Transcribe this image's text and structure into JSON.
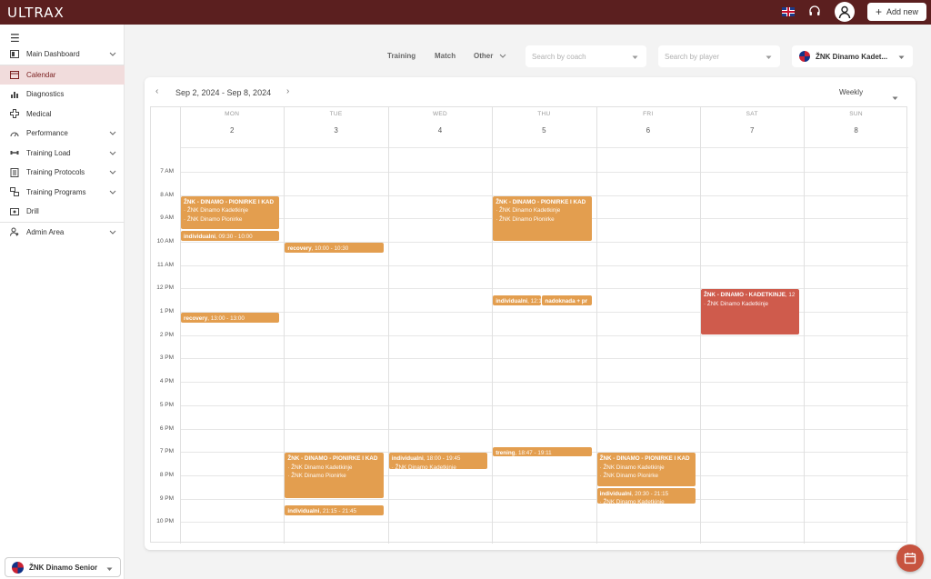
{
  "app": {
    "logo": "ULTRAX"
  },
  "header": {
    "add_new_label": "Add new",
    "icons": [
      "uk-flag-icon",
      "headset-icon",
      "user-avatar-icon"
    ]
  },
  "sidebar": {
    "items": [
      {
        "label": "Main Dashboard",
        "icon": "dashboard-icon",
        "expandable": true
      },
      {
        "label": "Calendar",
        "icon": "calendar-icon",
        "expandable": false,
        "active": true
      },
      {
        "label": "Diagnostics",
        "icon": "bar-chart-icon",
        "expandable": false
      },
      {
        "label": "Medical",
        "icon": "medical-icon",
        "expandable": false
      },
      {
        "label": "Performance",
        "icon": "speed-icon",
        "expandable": true
      },
      {
        "label": "Training Load",
        "icon": "load-icon",
        "expandable": true
      },
      {
        "label": "Training Protocols",
        "icon": "protocol-icon",
        "expandable": true
      },
      {
        "label": "Training Programs",
        "icon": "program-icon",
        "expandable": true
      },
      {
        "label": "Drill",
        "icon": "drill-icon",
        "expandable": false
      },
      {
        "label": "Admin Area",
        "icon": "admin-icon",
        "expandable": true
      }
    ],
    "team_selector": "ŽNK Dinamo Senior"
  },
  "filters": {
    "training": "Training",
    "match": "Match",
    "other": "Other",
    "coach_placeholder": "Search by coach",
    "player_placeholder": "Search by player",
    "team": "ŽNK Dinamo Kadet..."
  },
  "calendar": {
    "range": "Sep 2, 2024 - Sep 8, 2024",
    "view": "Weekly",
    "days": [
      {
        "name": "MON",
        "num": "2"
      },
      {
        "name": "TUE",
        "num": "3"
      },
      {
        "name": "WED",
        "num": "4"
      },
      {
        "name": "THU",
        "num": "5"
      },
      {
        "name": "FRI",
        "num": "6"
      },
      {
        "name": "SAT",
        "num": "7"
      },
      {
        "name": "SUN",
        "num": "8"
      }
    ],
    "hours": [
      "7 AM",
      "8 AM",
      "9 AM",
      "10 AM",
      "11 AM",
      "12 PM",
      "1 PM",
      "2 PM",
      "3 PM",
      "4 PM",
      "5 PM",
      "6 PM",
      "7 PM",
      "8 PM",
      "9 PM",
      "10 PM"
    ],
    "events": [
      {
        "day": 0,
        "start": 8.0,
        "end": 9.5,
        "title": "ŽNK - DINAMO - PIONIRKE I KAD",
        "time": "",
        "lines": [
          "ŽNK Dinamo Kadetkinje",
          "ŽNK Dinamo Pionirke"
        ],
        "color": "orange"
      },
      {
        "day": 0,
        "start": 9.5,
        "end": 10.0,
        "title": "individualni",
        "time": ", 09:30 - 10:00",
        "lines": [],
        "color": "orange"
      },
      {
        "day": 0,
        "start": 13.0,
        "end": 13.5,
        "title": "recovery",
        "time": ", 13:00 - 13:00",
        "lines": [],
        "color": "orange"
      },
      {
        "day": 1,
        "start": 10.0,
        "end": 10.5,
        "title": "recovery",
        "time": ", 10:00 - 10:30",
        "lines": [],
        "color": "orange"
      },
      {
        "day": 1,
        "start": 19.0,
        "end": 21.0,
        "title": "ŽNK - DINAMO - PIONIRKE I KAD",
        "time": "",
        "lines": [
          "ŽNK Dinamo Kadetkinje",
          "ŽNK Dinamo Pionirke"
        ],
        "color": "orange"
      },
      {
        "day": 1,
        "start": 21.25,
        "end": 21.75,
        "title": "individualni",
        "time": ", 21:15 - 21:45",
        "lines": [],
        "color": "orange"
      },
      {
        "day": 2,
        "start": 19.0,
        "end": 19.75,
        "title": "individualni",
        "time": ", 18:00 - 19:45",
        "lines": [
          "ŽNK Dinamo Kadetkinje"
        ],
        "color": "orange"
      },
      {
        "day": 3,
        "start": 8.0,
        "end": 10.0,
        "title": "ŽNK - DINAMO - PIONIRKE I KAD",
        "time": "",
        "lines": [
          "ŽNK Dinamo Kadetkinje",
          "ŽNK Dinamo Pionirke"
        ],
        "color": "orange"
      },
      {
        "day": 3,
        "start": 12.25,
        "end": 12.75,
        "title": "individualni",
        "time": ", 12:1",
        "lines": [],
        "color": "orange",
        "half": "left"
      },
      {
        "day": 3,
        "start": 12.25,
        "end": 12.75,
        "title": "nadoknada + pr",
        "time": "",
        "lines": [],
        "color": "orange",
        "half": "right"
      },
      {
        "day": 3,
        "start": 18.75,
        "end": 19.2,
        "title": "trening",
        "time": ", 18:47 - 19:11",
        "lines": [],
        "color": "orange"
      },
      {
        "day": 4,
        "start": 19.0,
        "end": 20.5,
        "title": "ŽNK - DINAMO - PIONIRKE I KAD",
        "time": "",
        "lines": [
          "ŽNK Dinamo Kadetkinje",
          "ŽNK Dinamo Pionirke"
        ],
        "color": "orange"
      },
      {
        "day": 4,
        "start": 20.5,
        "end": 21.25,
        "title": "individualni",
        "time": ", 20:30 - 21:15",
        "lines": [
          "ŽNK Dinamo Kadetkinje"
        ],
        "color": "orange"
      },
      {
        "day": 5,
        "start": 12.0,
        "end": 14.0,
        "title": "ŽNK - DINAMO - KADETKINJE",
        "time": ", 12",
        "lines": [
          "ŽNK Dinamo Kadetkinje"
        ],
        "color": "red"
      }
    ]
  }
}
